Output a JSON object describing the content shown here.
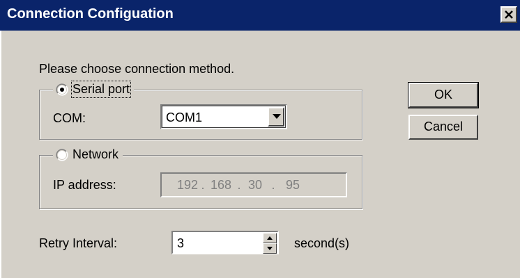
{
  "window": {
    "title": "Connection Configuation",
    "close_icon": "close-icon"
  },
  "prompt": "Please choose connection method.",
  "serial": {
    "radio_label": "Serial port",
    "selected": true,
    "com_label": "COM:",
    "com_value": "COM1"
  },
  "network": {
    "radio_label": "Network",
    "selected": false,
    "ip_label": "IP address:",
    "ip_octets": [
      "192",
      "168",
      "30",
      "95"
    ],
    "enabled": false
  },
  "retry": {
    "label": "Retry Interval:",
    "value": "3",
    "unit": "second(s)"
  },
  "buttons": {
    "ok": "OK",
    "cancel": "Cancel"
  },
  "colors": {
    "titlebar": "#0a246a",
    "face": "#d4d0c8",
    "disabled_text": "#808080"
  }
}
